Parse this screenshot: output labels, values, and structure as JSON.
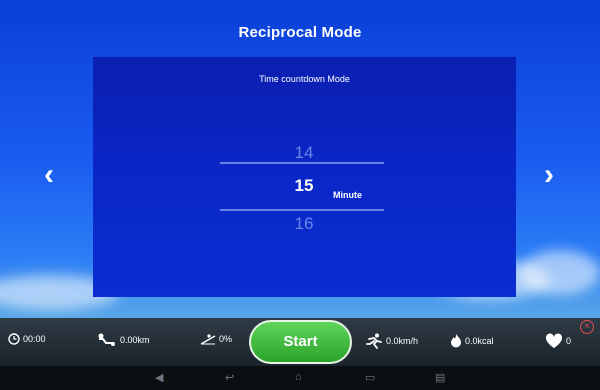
{
  "header": {
    "title": "Reciprocal Mode"
  },
  "panel": {
    "subtitle": "Time countdown Mode",
    "picker": {
      "prev": "14",
      "current": "15",
      "next": "16",
      "unit": "Minute"
    }
  },
  "nav": {
    "left_arrow": "‹",
    "right_arrow": "›"
  },
  "bottom_bar": {
    "time": "00:00",
    "distance": "0.00km",
    "incline": "0%",
    "start_label": "Start",
    "speed": "0.0km/h",
    "calories": "0.0kcal",
    "heart_rate": "0"
  },
  "colors": {
    "accent_green": "#3cb83a",
    "panel_blue": "#0a27c8",
    "close_red": "#e05050"
  }
}
